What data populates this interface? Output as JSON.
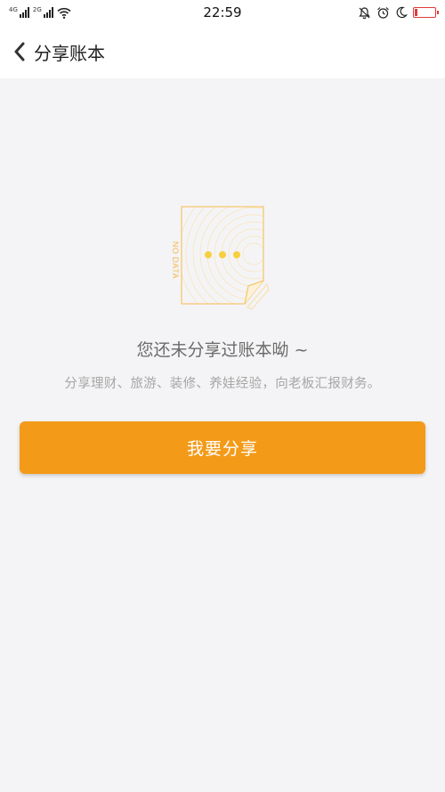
{
  "status_bar": {
    "sim1_label": "4G",
    "sim2_label": "2G",
    "time": "22:59",
    "battery_level": 0.12,
    "battery_color": "#e13a3a"
  },
  "header": {
    "title": "分享账本"
  },
  "empty_state": {
    "illustration_text": "NO DATA",
    "message": "您还未分享过账本呦 ~",
    "description": "分享理财、旅游、装修、养娃经验，向老板汇报财务。"
  },
  "actions": {
    "share_button_label": "我要分享"
  },
  "colors": {
    "accent": "#f39b19",
    "background": "#f4f4f6",
    "illustration": "#f6c870"
  }
}
